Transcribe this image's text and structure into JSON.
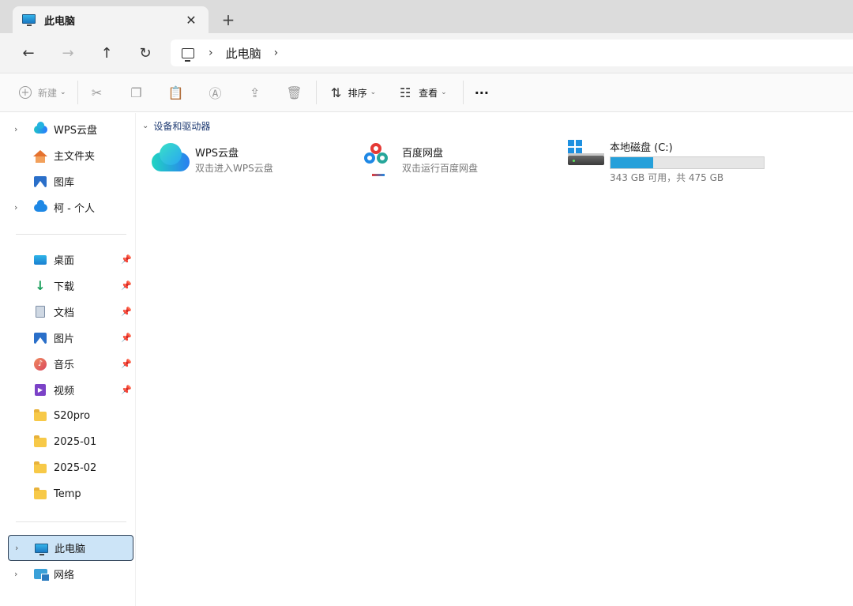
{
  "tab": {
    "title": "此电脑",
    "close": "✕",
    "new_tab": "+"
  },
  "nav": {
    "back": "←",
    "forward": "→",
    "up": "↑",
    "refresh": "↻"
  },
  "address": {
    "crumbs": [
      "此电脑"
    ],
    "separator": "›"
  },
  "commands": {
    "new_label": "新建",
    "sort_label": "排序",
    "view_label": "查看",
    "more": "···",
    "icons": [
      "cut-icon",
      "copy-icon",
      "paste-icon",
      "rename-icon",
      "share-icon",
      "delete-icon"
    ]
  },
  "sidebar": {
    "top": [
      {
        "label": "WPS云盘",
        "icon": "wps-cloud-icon",
        "expandable": true
      },
      {
        "label": "主文件夹",
        "icon": "home-icon",
        "expandable": false
      },
      {
        "label": "图库",
        "icon": "gallery-icon",
        "expandable": false
      },
      {
        "label": "柯 - 个人",
        "icon": "onedrive-icon",
        "expandable": true
      }
    ],
    "quick": [
      {
        "label": "桌面",
        "icon": "desktop-icon",
        "pinned": true
      },
      {
        "label": "下载",
        "icon": "download-icon",
        "pinned": true
      },
      {
        "label": "文档",
        "icon": "document-icon",
        "pinned": true
      },
      {
        "label": "图片",
        "icon": "pictures-icon",
        "pinned": true
      },
      {
        "label": "音乐",
        "icon": "music-icon",
        "pinned": true
      },
      {
        "label": "视频",
        "icon": "video-icon",
        "pinned": true
      },
      {
        "label": "S20pro",
        "icon": "folder-icon",
        "pinned": false
      },
      {
        "label": "2025-01",
        "icon": "folder-icon",
        "pinned": false
      },
      {
        "label": "2025-02",
        "icon": "folder-icon",
        "pinned": false
      },
      {
        "label": "Temp",
        "icon": "folder-icon",
        "pinned": false
      }
    ],
    "bottom": [
      {
        "label": "此电脑",
        "icon": "this-pc-icon",
        "selected": true
      },
      {
        "label": "网络",
        "icon": "network-icon",
        "selected": false
      }
    ]
  },
  "content": {
    "group_title": "设备和驱动器",
    "items": [
      {
        "name": "WPS云盘",
        "subtitle": "双击进入WPS云盘",
        "icon": "wps-cloud-icon"
      },
      {
        "name": "百度网盘",
        "subtitle": "双击运行百度网盘",
        "icon": "baidu-netdisk-icon"
      },
      {
        "name": "本地磁盘 (C:)",
        "subtitle": "343 GB 可用，共 475 GB",
        "icon": "local-disk-icon",
        "used_fraction": 0.278
      }
    ]
  },
  "colors": {
    "accent": "#26a0da",
    "selected_bg": "#cce4f7",
    "group_title": "#1f3b73"
  }
}
